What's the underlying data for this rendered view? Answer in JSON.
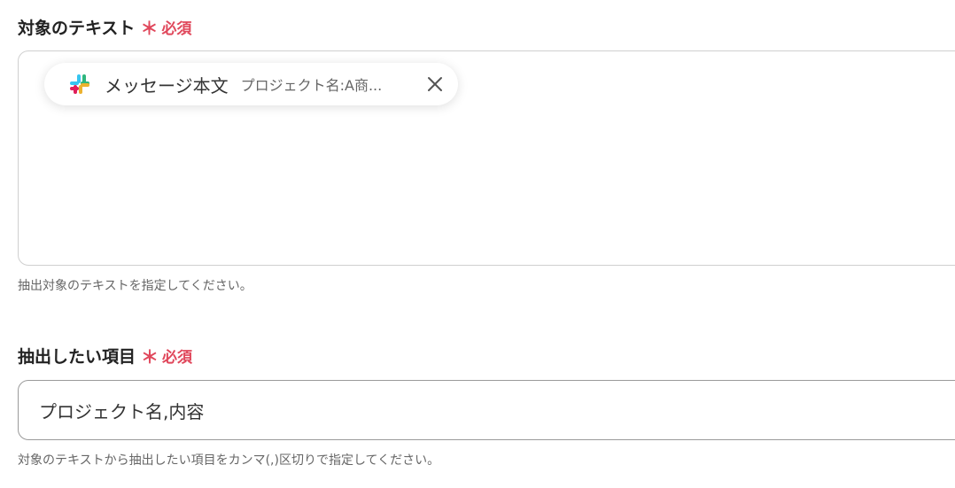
{
  "field1": {
    "label": "対象のテキスト",
    "required_mark": "＊",
    "required_text": "必須",
    "chip": {
      "icon": "slack-icon",
      "title": "メッセージ本文",
      "preview": "プロジェクト名:A商...",
      "close_icon": "close-icon"
    },
    "help": "抽出対象のテキストを指定してください。"
  },
  "field2": {
    "label": "抽出したい項目",
    "required_mark": "＊",
    "required_text": "必須",
    "value": "プロジェクト名,内容",
    "help": "対象のテキストから抽出したい項目をカンマ(,)区切りで指定してください。"
  },
  "colors": {
    "required": "#e0475b",
    "text": "#333333",
    "help": "#666666",
    "border": "#cfcfcf"
  }
}
